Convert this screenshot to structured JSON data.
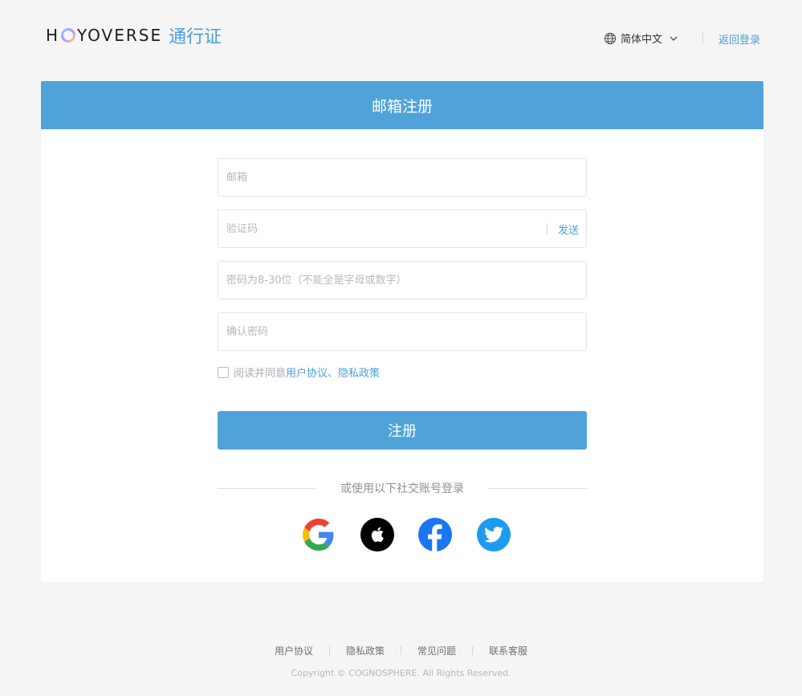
{
  "header": {
    "logo_text_left": "H",
    "logo_text_right": "YOVERSE",
    "logo_suffix": "通行证",
    "language": "简体中文",
    "back_login": "返回登录"
  },
  "card": {
    "title": "邮箱注册",
    "fields": {
      "email_placeholder": "邮箱",
      "code_placeholder": "验证码",
      "send_label": "发送",
      "password_placeholder": "密码为8-30位（不能全是字母或数字）",
      "confirm_placeholder": "确认密码"
    },
    "agreement": {
      "prefix": "阅读并同意",
      "user_agreement": "用户协议",
      "separator": "、",
      "privacy_policy": "隐私政策"
    },
    "submit_label": "注册",
    "social_text": "或使用以下社交账号登录",
    "social": [
      "google-icon",
      "apple-icon",
      "facebook-icon",
      "twitter-icon"
    ]
  },
  "footer": {
    "links": [
      "用户协议",
      "隐私政策",
      "常见问题",
      "联系客服"
    ],
    "copyright": "Copyright © COGNOSPHERE. All Rights Reserved."
  },
  "colors": {
    "brand_blue": "#4fa3d9",
    "link_blue": "#4a9fd8",
    "background": "#f5f5f6"
  }
}
